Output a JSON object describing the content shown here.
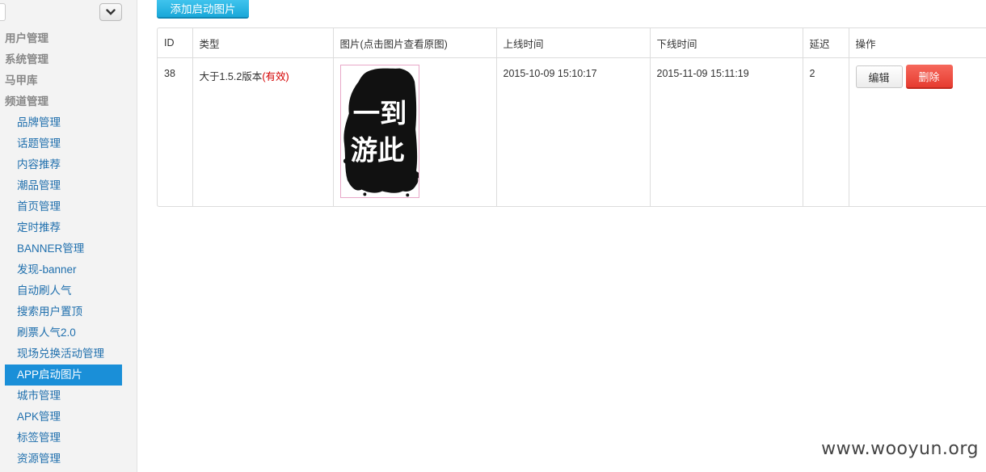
{
  "sidebar": {
    "items": [
      {
        "label": "用户管理",
        "type": "cat"
      },
      {
        "label": "系统管理",
        "type": "cat"
      },
      {
        "label": "马甲库",
        "type": "cat"
      },
      {
        "label": "频道管理",
        "type": "cat"
      },
      {
        "label": "品牌管理",
        "type": "sub"
      },
      {
        "label": "话题管理",
        "type": "sub"
      },
      {
        "label": "内容推荐",
        "type": "sub"
      },
      {
        "label": "潮品管理",
        "type": "sub"
      },
      {
        "label": "首页管理",
        "type": "sub"
      },
      {
        "label": "定时推荐",
        "type": "sub"
      },
      {
        "label": "BANNER管理",
        "type": "sub"
      },
      {
        "label": "发现-banner",
        "type": "sub"
      },
      {
        "label": "自动刷人气",
        "type": "sub"
      },
      {
        "label": "搜索用户置顶",
        "type": "sub"
      },
      {
        "label": "刷票人气2.0",
        "type": "sub"
      },
      {
        "label": "现场兑换活动管理",
        "type": "sub"
      },
      {
        "label": "APP启动图片",
        "type": "sub",
        "active": true
      },
      {
        "label": "城市管理",
        "type": "sub"
      },
      {
        "label": "APK管理",
        "type": "sub"
      },
      {
        "label": "标签管理",
        "type": "sub"
      },
      {
        "label": "资源管理",
        "type": "sub"
      }
    ]
  },
  "toolbar": {
    "add_label": "添加启动图片"
  },
  "table": {
    "headers": [
      "ID",
      "类型",
      "图片(点击图片查看原图)",
      "上线时间",
      "下线时间",
      "延迟",
      "操作"
    ],
    "rows": [
      {
        "id": "38",
        "type": "大于1.5.2版本",
        "status": "(有效)",
        "image_text": "一到 游此",
        "online": "2015-10-09 15:10:17",
        "offline": "2015-11-09 15:11:19",
        "delay": "2",
        "edit_label": "编辑",
        "delete_label": "删除"
      }
    ]
  },
  "watermark": "www.wooyun.org"
}
